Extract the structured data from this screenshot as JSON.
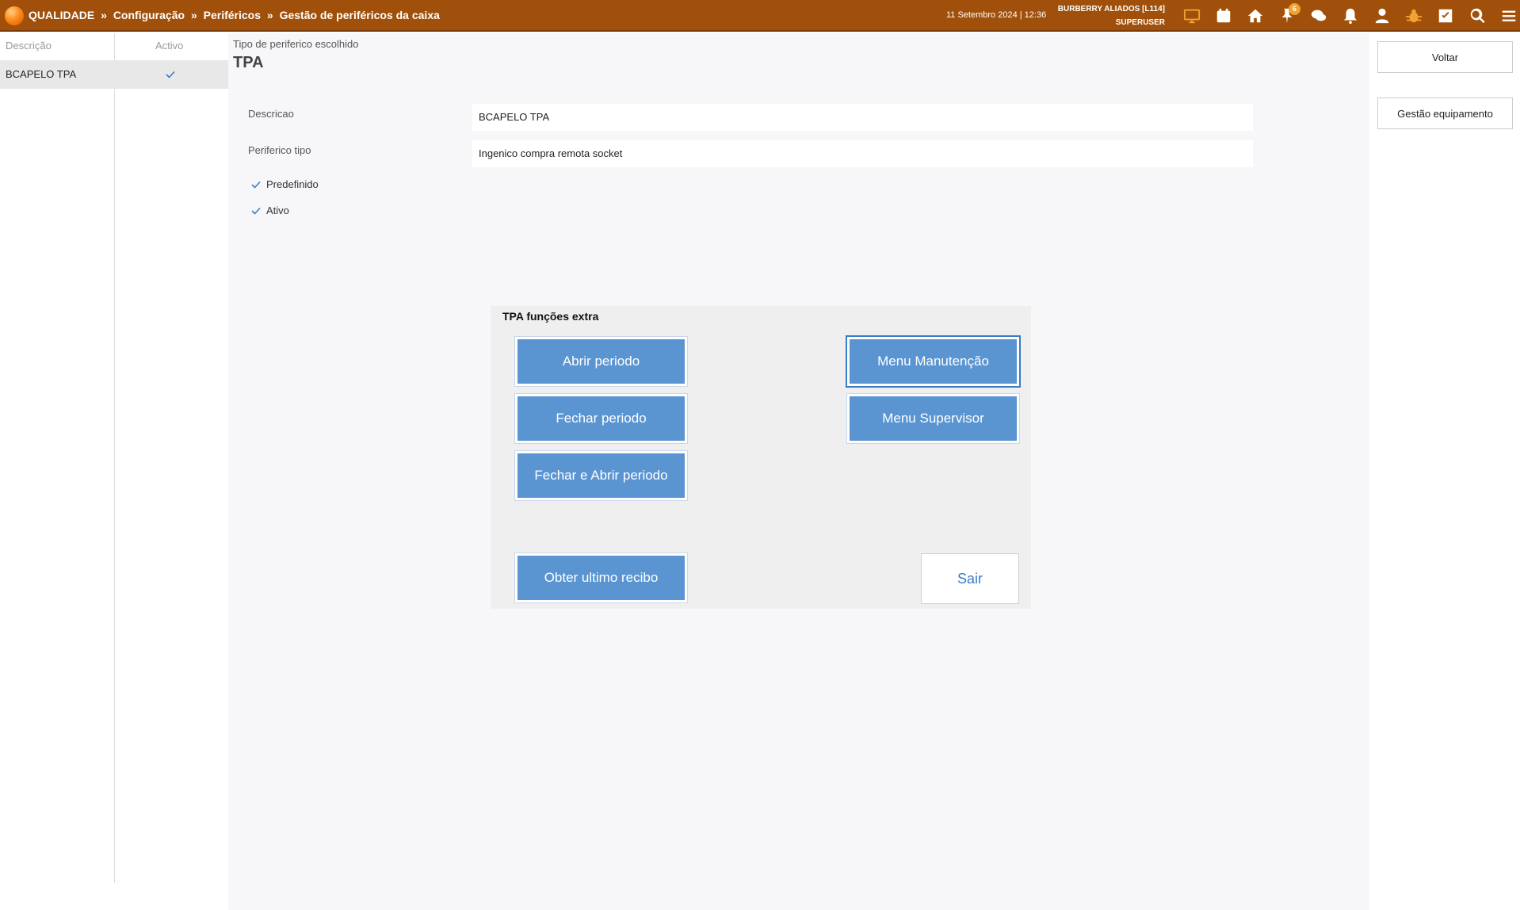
{
  "topbar": {
    "breadcrumb": [
      "QUALIDADE",
      "Configuração",
      "Periféricos",
      "Gestão de periféricos da caixa"
    ],
    "breadcrumb_sep": "»",
    "datetime": "11 Setembro 2024 | 12:36",
    "store": "BURBERRY ALIADOS [L114]",
    "user": "SUPERUSER",
    "notifications_badge": "6",
    "icons": [
      "monitor-icon",
      "calendar-icon",
      "home-icon",
      "pin-icon",
      "chat-icon",
      "bell-icon",
      "user-icon",
      "bug-icon",
      "checkbox-icon",
      "search-icon",
      "menu-icon"
    ],
    "bar_color": "#a0500a",
    "accent_color": "#f2a230"
  },
  "list": {
    "col_description": "Descrição",
    "col_active": "Activo",
    "rows": [
      {
        "name": "BCAPELO TPA",
        "active": true
      }
    ]
  },
  "main": {
    "peripheral_type_label": "Tipo de periferico escolhido",
    "peripheral_type_value": "TPA",
    "fields": {
      "description_label": "Descricao",
      "description_value": "BCAPELO TPA",
      "type_label": "Periferico tipo",
      "type_value": "Ingenico compra remota socket"
    },
    "checkboxes": {
      "default_label": "Predefinido",
      "default_checked": true,
      "active_label": "Ativo",
      "active_checked": true
    }
  },
  "dialog": {
    "title": "TPA funções extra",
    "buttons": {
      "open_period": "Abrir periodo",
      "close_period": "Fechar periodo",
      "close_open_period": "Fechar e Abrir periodo",
      "last_receipt": "Obter ultimo recibo",
      "maintenance_menu": "Menu Manutenção",
      "supervisor_menu": "Menu Supervisor",
      "exit": "Sair"
    },
    "button_color": "#5a95d2"
  },
  "right": {
    "back_label": "Voltar",
    "equipment_label": "Gestão equipamento"
  }
}
